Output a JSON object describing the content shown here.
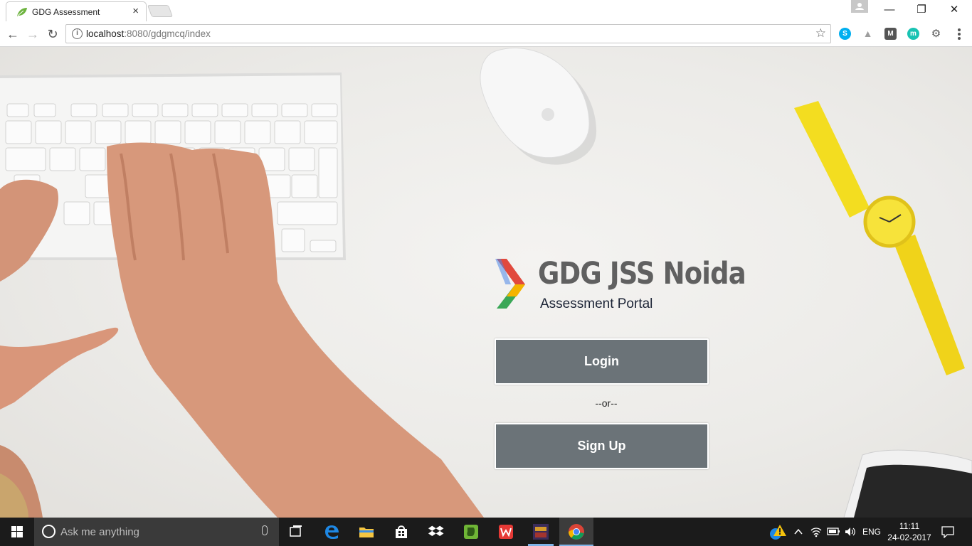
{
  "browser": {
    "tab_title": "GDG Assessment",
    "tab_close": "×",
    "url_host": "localhost",
    "url_path": ":8080/gdgmcq/index",
    "window_controls": {
      "minimize": "—",
      "restore": "❐",
      "close": "✕"
    },
    "nav": {
      "back": "←",
      "forward": "→",
      "reload": "↻",
      "star": "☆"
    },
    "extensions": [
      {
        "name": "skype-extension-icon",
        "glyph": "S",
        "color": "#00aff0"
      },
      {
        "name": "drive-extension-icon",
        "glyph": "▲",
        "color": "#9e9e9e"
      },
      {
        "name": "m-box-extension-icon",
        "glyph": "M",
        "color": "#555555"
      },
      {
        "name": "m-circle-extension-icon",
        "glyph": "m",
        "color": "#19c3b3"
      },
      {
        "name": "chrome-settings-extension-icon",
        "glyph": "⚙",
        "color": "#555555"
      }
    ]
  },
  "page": {
    "brand_title": "GDG JSS Noida",
    "brand_subtitle": "Assessment Portal",
    "login_label": "Login",
    "separator": "--or--",
    "signup_label": "Sign Up",
    "button_color": "#6b7378"
  },
  "taskbar": {
    "search_placeholder": "Ask me anything",
    "language": "ENG",
    "time": "11:11",
    "date": "24-02-2017"
  }
}
